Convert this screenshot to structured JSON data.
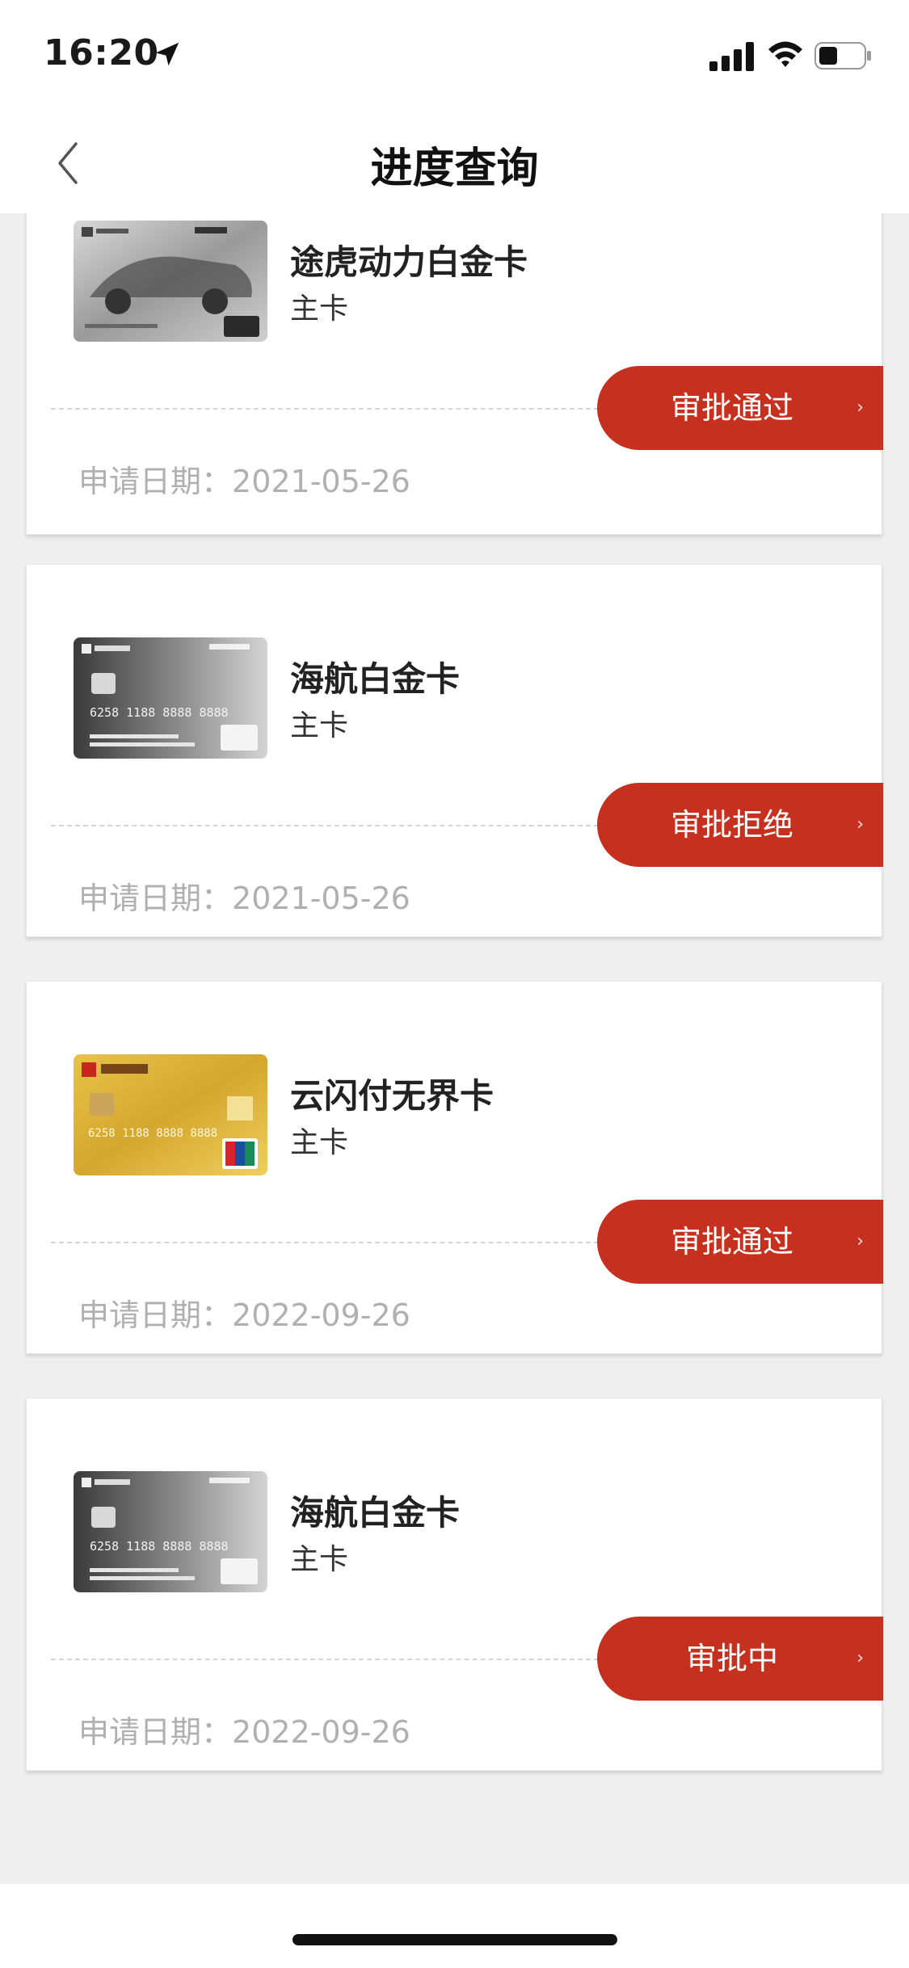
{
  "status_bar": {
    "time": "16:20"
  },
  "nav": {
    "title": "进度查询"
  },
  "cards": [
    {
      "name": "途虎动力白金卡",
      "type": "主卡",
      "status": "审批通过",
      "date_label": "申请日期：",
      "date": "2021-05-26",
      "art": "silver"
    },
    {
      "name": "海航白金卡",
      "type": "主卡",
      "status": "审批拒绝",
      "date_label": "申请日期：",
      "date": "2021-05-26",
      "art": "dark"
    },
    {
      "name": "云闪付无界卡",
      "type": "主卡",
      "status": "审批通过",
      "date_label": "申请日期：",
      "date": "2022-09-26",
      "art": "gold"
    },
    {
      "name": "海航白金卡",
      "type": "主卡",
      "status": "审批中",
      "date_label": "申请日期：",
      "date": "2022-09-26",
      "art": "dark"
    }
  ],
  "colors": {
    "accent": "#c5301f",
    "background": "#efefef",
    "date_text": "#b0b0b0"
  },
  "icons": {
    "back": "chevron-left-icon",
    "status_arrow": "chevron-right-icon",
    "location": "location-arrow-icon",
    "signal": "cellular-signal-icon",
    "wifi": "wifi-icon",
    "battery": "battery-icon"
  }
}
